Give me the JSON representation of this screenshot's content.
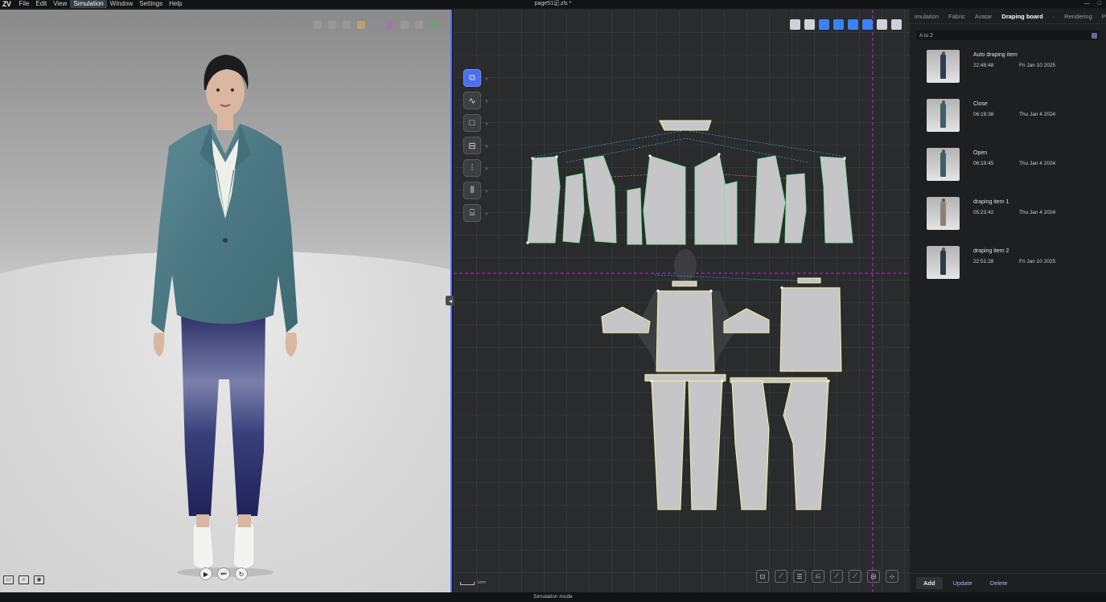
{
  "menubar": {
    "logo": "ZV",
    "items": [
      {
        "label": "File"
      },
      {
        "label": "Edit"
      },
      {
        "label": "View"
      },
      {
        "label": "Simulation",
        "active": true
      },
      {
        "label": "Window"
      },
      {
        "label": "Settings"
      },
      {
        "label": "Help"
      }
    ],
    "document_title": "page51记.zls *",
    "window_controls": [
      "—",
      "□"
    ]
  },
  "viewport3d": {
    "toolbar_icons": [
      "wire-icon",
      "sphere-icon",
      "texture-icon",
      "avatar-icon",
      "lights-icon",
      "color-icon",
      "layer-icon",
      "camera-icon",
      "pin-icon"
    ],
    "playback": {
      "play": "▶",
      "step": "⏭",
      "reset": "↻"
    },
    "bottom_left_icons": [
      "▭",
      "⌕",
      "◉"
    ],
    "colors": {
      "jacket": "#4d7a86",
      "jeans": "#2c2f6a",
      "shirt": "#efefea",
      "shoes": "#f3f3f1",
      "hair": "#1c1b1d",
      "skin": "#d9b7a0"
    }
  },
  "pattern2d": {
    "toolbar_icons": [
      "trans-icon",
      "grid-icon",
      "blue1",
      "blue2",
      "blue3",
      "blue4",
      "misc1",
      "misc2"
    ],
    "side_tools": [
      {
        "name": "transform-pattern-tool",
        "glyph": "⧉",
        "active": true
      },
      {
        "name": "curve-tool",
        "glyph": "∿"
      },
      {
        "name": "rectangle-tool",
        "glyph": "□"
      },
      {
        "name": "internal-shape-tool",
        "glyph": "⊟"
      },
      {
        "name": "zipper-tool",
        "glyph": "⫶"
      },
      {
        "name": "fold-tool",
        "glyph": "⦀"
      },
      {
        "name": "button-tool",
        "glyph": "⌸"
      }
    ],
    "bottom_tools": [
      "⊡",
      "⟋",
      "☰",
      "⎌",
      "⟋",
      "⟋",
      "⊟",
      "⊹"
    ],
    "scale_label": "1mm",
    "collapse_glyph": "◂"
  },
  "rpanel": {
    "tabs": [
      {
        "label": "imulation"
      },
      {
        "label": "Fabric"
      },
      {
        "label": "Avatar"
      },
      {
        "label": "Draping board",
        "active": true
      },
      {
        "label": "·"
      },
      {
        "label": "Rendering"
      },
      {
        "label": "Properties"
      }
    ],
    "sort_label": "A to Z",
    "items": [
      {
        "name": "Auto draping item",
        "time": "22:48:48",
        "date": "Fri Jan 10 2025",
        "fig_color": "#2d3e55"
      },
      {
        "name": "Close",
        "time": "06:19:38",
        "date": "Thu Jan 4 2024",
        "fig_color": "#3f5f6a"
      },
      {
        "name": "Open",
        "time": "06:19:45",
        "date": "Thu Jan 4 2024",
        "fig_color": "#3f5f6a"
      },
      {
        "name": "draping item 1",
        "time": "05:23:42",
        "date": "Thu Jan 4 2024",
        "fig_color": "#8a8178"
      },
      {
        "name": "draping item 2",
        "time": "22:51:28",
        "date": "Fri Jan 10 2025",
        "fig_color": "#2f3a48"
      }
    ],
    "footer": {
      "add": "Add",
      "update": "Update",
      "delete": "Delete"
    }
  },
  "status": {
    "text": "Simulation mode"
  }
}
